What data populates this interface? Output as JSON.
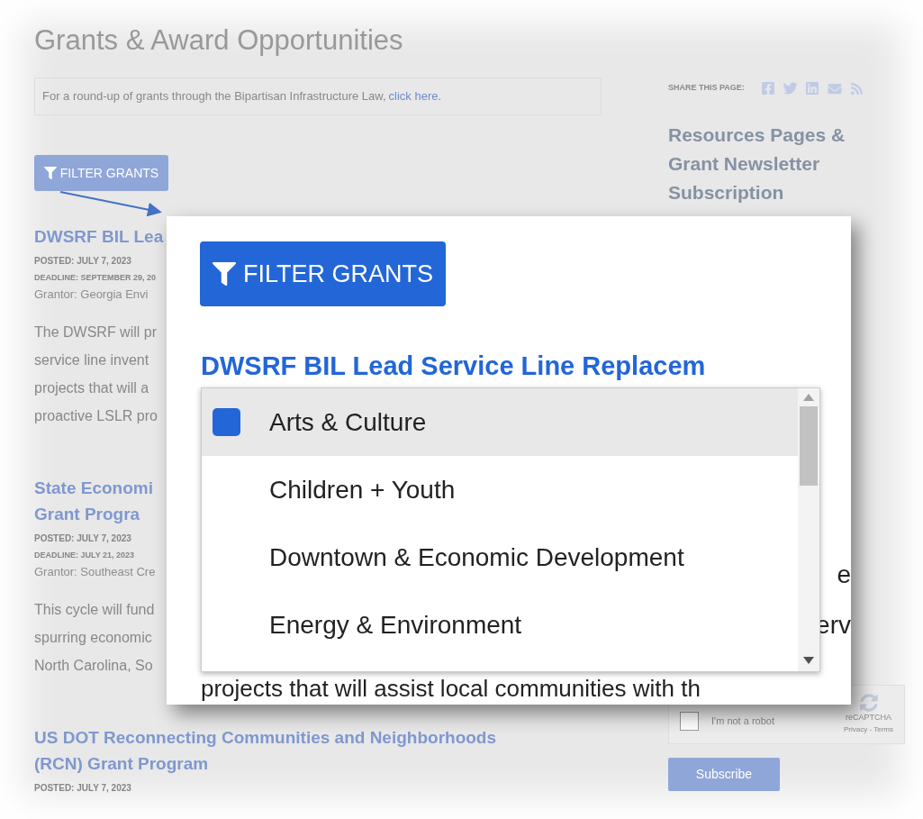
{
  "page": {
    "title": "Grants & Award Opportunities",
    "notice": {
      "text": "For a round-up of grants through the Bipartisan Infrastructure Law, ",
      "link": "click here."
    },
    "filter_button": "FILTER GRANTS",
    "grants": [
      {
        "title_lines": [
          "DWSRF BIL Lea"
        ],
        "posted": "POSTED: JULY 7, 2023",
        "deadline": "DEADLINE: SEPTEMBER 29, 20",
        "grantor": "Grantor: Georgia Envi",
        "description_lines": [
          "The DWSRF will pr",
          "service line invent",
          "projects that will a",
          "proactive LSLR pro"
        ]
      },
      {
        "title_lines": [
          "State Economi",
          "Grant Progra"
        ],
        "posted": "POSTED: JULY 7, 2023",
        "deadline": "DEADLINE: JULY 21, 2023",
        "grantor": "Grantor: Southeast Cre",
        "description_lines": [
          "This cycle will fund",
          "spurring economic",
          "North Carolina, So"
        ]
      },
      {
        "title_lines": [
          "US DOT Reconnecting Communities and Neighborhoods",
          "(RCN) Grant Program"
        ],
        "posted": "POSTED: JULY 7, 2023"
      }
    ],
    "sidebar": {
      "share_label": "SHARE THIS PAGE:",
      "heading": "Resources Pages & Grant Newsletter Subscription",
      "captcha": {
        "checked": false,
        "label": "I'm not a robot",
        "brand": "reCAPTCHA",
        "links": "Privacy - Terms"
      },
      "subscribe_button": "Subscribe"
    }
  },
  "callout": {
    "filter_button": "FILTER GRANTS",
    "heading": "DWSRF BIL Lead Service Line Replacem",
    "fragments": [
      "e",
      "erv"
    ],
    "last_line": "projects that will assist local communities with th",
    "dropdown": {
      "items": [
        {
          "label": "Arts & Culture",
          "selected": true,
          "checked": true
        },
        {
          "label": "Children + Youth",
          "selected": false,
          "checked": false
        },
        {
          "label": "Downtown & Economic Development",
          "selected": false,
          "checked": false
        },
        {
          "label": "Energy & Environment",
          "selected": false,
          "checked": false
        }
      ]
    }
  }
}
